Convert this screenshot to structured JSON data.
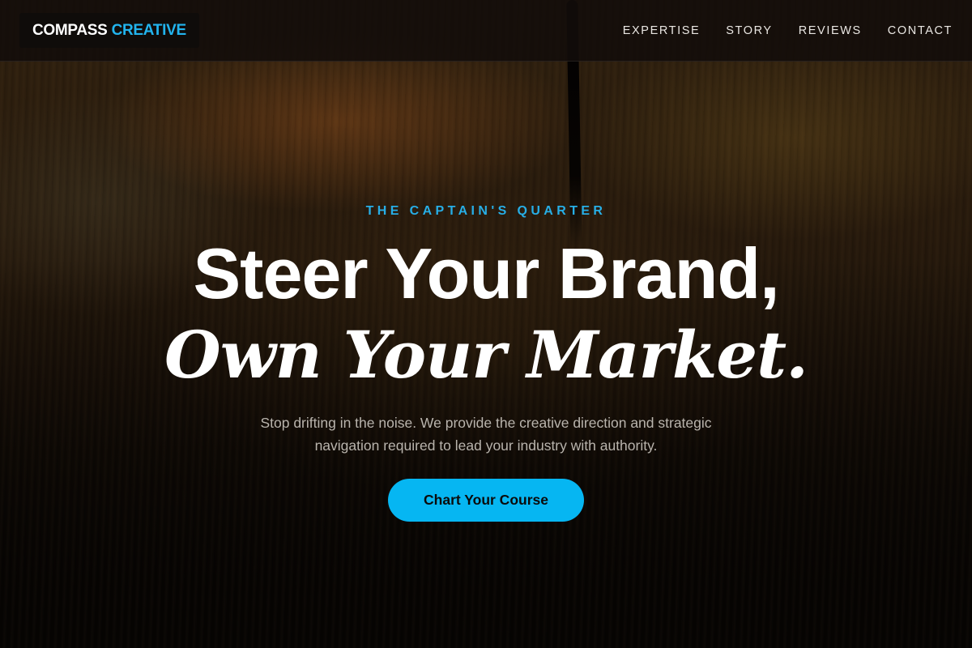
{
  "header": {
    "logo": {
      "part1": "COMPASS",
      "part2": "CREATIVE"
    },
    "nav": [
      {
        "label": "EXPERTISE"
      },
      {
        "label": "STORY"
      },
      {
        "label": "REVIEWS"
      },
      {
        "label": "CONTACT"
      }
    ]
  },
  "hero": {
    "eyebrow": "THE CAPTAIN'S QUARTER",
    "headline_line1": "Steer Your Brand,",
    "headline_line2": "Own Your Market.",
    "subtext": "Stop drifting in the noise. We provide the creative direction and strategic navigation required to lead your industry with authority.",
    "cta_label": "Chart Your Course"
  },
  "colors": {
    "accent": "#06b6f2",
    "logo_accent": "#22b4ee",
    "eyebrow": "#27aee6",
    "header_bg": "#120d0a"
  }
}
